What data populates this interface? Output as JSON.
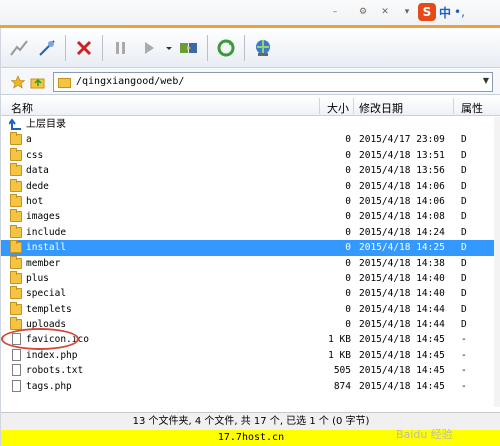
{
  "ime": {
    "logo": "S",
    "mode": "中",
    "punct": "•,"
  },
  "address": {
    "path": "/qingxiangood/web/"
  },
  "columns": {
    "name": "名称",
    "size": "大小",
    "date": "修改日期",
    "type": "属性"
  },
  "parent_row": {
    "name": "上层目录"
  },
  "rows": [
    {
      "name": "a",
      "size": "0",
      "date": "2015/4/17 23:09",
      "type": "D",
      "kind": "folder"
    },
    {
      "name": "css",
      "size": "0",
      "date": "2015/4/18 13:51",
      "type": "D",
      "kind": "folder"
    },
    {
      "name": "data",
      "size": "0",
      "date": "2015/4/18 13:56",
      "type": "D",
      "kind": "folder"
    },
    {
      "name": "dede",
      "size": "0",
      "date": "2015/4/18 14:06",
      "type": "D",
      "kind": "folder"
    },
    {
      "name": "hot",
      "size": "0",
      "date": "2015/4/18 14:06",
      "type": "D",
      "kind": "folder"
    },
    {
      "name": "images",
      "size": "0",
      "date": "2015/4/18 14:08",
      "type": "D",
      "kind": "folder"
    },
    {
      "name": "include",
      "size": "0",
      "date": "2015/4/18 14:24",
      "type": "D",
      "kind": "folder"
    },
    {
      "name": "install",
      "size": "0",
      "date": "2015/4/18 14:25",
      "type": "D",
      "kind": "folder",
      "selected": true
    },
    {
      "name": "member",
      "size": "0",
      "date": "2015/4/18 14:38",
      "type": "D",
      "kind": "folder"
    },
    {
      "name": "plus",
      "size": "0",
      "date": "2015/4/18 14:40",
      "type": "D",
      "kind": "folder"
    },
    {
      "name": "special",
      "size": "0",
      "date": "2015/4/18 14:40",
      "type": "D",
      "kind": "folder"
    },
    {
      "name": "templets",
      "size": "0",
      "date": "2015/4/18 14:44",
      "type": "D",
      "kind": "folder"
    },
    {
      "name": "uploads",
      "size": "0",
      "date": "2015/4/18 14:44",
      "type": "D",
      "kind": "folder"
    },
    {
      "name": "favicon.ico",
      "size": "1 KB",
      "date": "2015/4/18 14:45",
      "type": "-",
      "kind": "file"
    },
    {
      "name": "index.php",
      "size": "1 KB",
      "date": "2015/4/18 14:45",
      "type": "-",
      "kind": "file"
    },
    {
      "name": "robots.txt",
      "size": "505",
      "date": "2015/4/18 14:45",
      "type": "-",
      "kind": "file"
    },
    {
      "name": "tags.php",
      "size": "874",
      "date": "2015/4/18 14:45",
      "type": "-",
      "kind": "file"
    }
  ],
  "status": {
    "summary": "13 个文件夹, 4 个文件, 共 17 个, 已选 1 个 (0 字节)",
    "host": "17.7host.cn"
  },
  "watermark": "Baidu 经验",
  "colors": {
    "selected": "#3399ff",
    "status_host_bg": "#ffff00",
    "circle": "#d24a3a"
  }
}
